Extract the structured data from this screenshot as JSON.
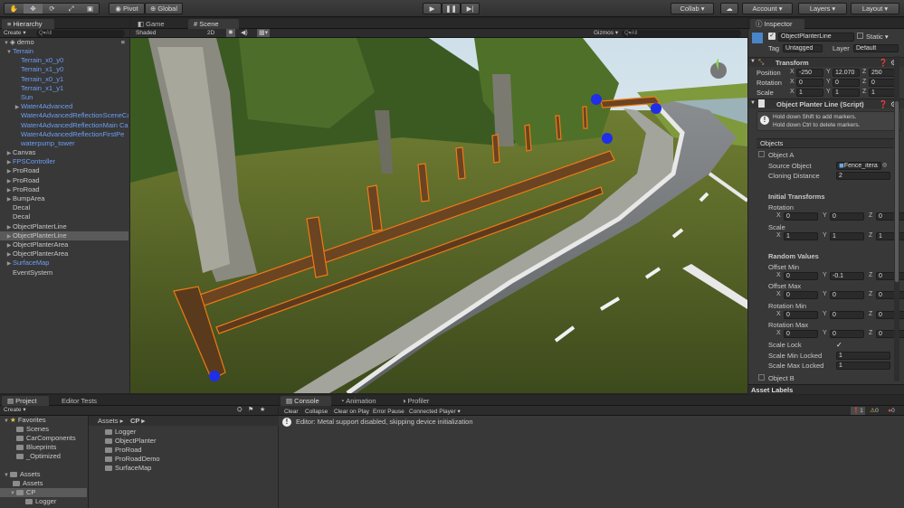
{
  "toolbar": {
    "pivot": "Pivot",
    "global": "Global",
    "collab": "Collab ▾",
    "account": "Account ▾",
    "layers": "Layers ▾",
    "layout": "Layout ▾"
  },
  "hierarchy": {
    "tab": "Hierarchy",
    "create": "Create ▾",
    "search_placeholder": "Q▾All",
    "scene": "demo",
    "items": [
      {
        "label": "Terrain",
        "indent": 1,
        "arrow": "▼",
        "blue": true
      },
      {
        "label": "Terrain_x0_y0",
        "indent": 2,
        "blue": true
      },
      {
        "label": "Terrain_x1_y0",
        "indent": 2,
        "blue": true
      },
      {
        "label": "Terrain_x0_y1",
        "indent": 2,
        "blue": true
      },
      {
        "label": "Terrain_x1_y1",
        "indent": 2,
        "blue": true
      },
      {
        "label": "Sun",
        "indent": 2,
        "blue": true
      },
      {
        "label": "Water4Advanced",
        "indent": 2,
        "arrow": "▶",
        "blue": true
      },
      {
        "label": "Water4AdvancedReflectionSceneCa",
        "indent": 2,
        "blue": true
      },
      {
        "label": "Water4AdvancedReflectionMain Ca",
        "indent": 2,
        "blue": true
      },
      {
        "label": "Water4AdvancedReflectionFirstPe",
        "indent": 2,
        "blue": true
      },
      {
        "label": "waterpump_tower",
        "indent": 2,
        "blue": true
      },
      {
        "label": "Canvas",
        "indent": 1,
        "arrow": "▶"
      },
      {
        "label": "FPSController",
        "indent": 1,
        "arrow": "▶",
        "blue": true
      },
      {
        "label": "ProRoad",
        "indent": 1,
        "arrow": "▶"
      },
      {
        "label": "ProRoad",
        "indent": 1,
        "arrow": "▶"
      },
      {
        "label": "ProRoad",
        "indent": 1,
        "arrow": "▶"
      },
      {
        "label": "BumpArea",
        "indent": 1,
        "arrow": "▶"
      },
      {
        "label": "Decal",
        "indent": 1
      },
      {
        "label": "Decal",
        "indent": 1
      },
      {
        "label": "ObjectPlanterLine",
        "indent": 1,
        "arrow": "▶"
      },
      {
        "label": "ObjectPlanterLine",
        "indent": 1,
        "arrow": "▶",
        "selected": true
      },
      {
        "label": "ObjectPlanterArea",
        "indent": 1,
        "arrow": "▶"
      },
      {
        "label": "ObjectPlanterArea",
        "indent": 1,
        "arrow": "▶"
      },
      {
        "label": "SurfaceMap",
        "indent": 1,
        "arrow": "▶",
        "blue": true
      },
      {
        "label": "EventSystem",
        "indent": 1
      }
    ]
  },
  "scene": {
    "game_tab": "Game",
    "scene_tab": "Scene",
    "shaded": "Shaded",
    "mode_2d": "2D",
    "gizmos": "Gizmos ▾",
    "search": "Q▾All"
  },
  "inspector": {
    "tab": "Inspector",
    "object_name": "ObjectPlanterLine",
    "static": "Static ▾",
    "tag_label": "Tag",
    "tag_value": "Untagged",
    "layer_label": "Layer",
    "layer_value": "Default",
    "transform": {
      "title": "Transform",
      "position": "Position",
      "rotation": "Rotation",
      "scale": "Scale",
      "px": "-250",
      "py": "12.070",
      "pz": "250",
      "rx": "0",
      "ry": "0",
      "rz": "0",
      "sx": "1",
      "sy": "1",
      "sz": "1"
    },
    "script": {
      "title": "Object Planter Line (Script)",
      "help1": "Hold down Shift to add markers.",
      "help2": "Hold down Ctrl to delete markers.",
      "objects": "Objects",
      "object_a": "Object A",
      "source_object": "Source Object",
      "source_value": "Fence_itera",
      "cloning_distance": "Cloning Distance",
      "cloning_value": "2",
      "initial_transforms": "Initial Transforms",
      "rotation": "Rotation",
      "scale": "Scale",
      "random_values": "Random Values",
      "offset_min": "Offset Min",
      "offset_max": "Offset Max",
      "rotation_min": "Rotation Min",
      "rotation_max": "Rotation Max",
      "scale_lock": "Scale Lock",
      "scale_min_locked": "Scale Min Locked",
      "scale_max_locked": "Scale Max Locked",
      "object_b": "Object B"
    },
    "vals": {
      "ir_x": "0",
      "ir_y": "0",
      "ir_z": "0",
      "is_x": "1",
      "is_y": "1",
      "is_z": "1",
      "omin_x": "0",
      "omin_y": "-0.1",
      "omin_z": "0",
      "omax_x": "0",
      "omax_y": "0",
      "omax_z": "0",
      "rmin_x": "0",
      "rmin_y": "0",
      "rmin_z": "0",
      "rmax_x": "0",
      "rmax_y": "0",
      "rmax_z": "0",
      "sminl": "1",
      "smaxl": "1"
    },
    "asset_labels": "Asset Labels"
  },
  "axes": {
    "x": "X",
    "y": "Y",
    "z": "Z"
  },
  "project": {
    "tab": "Project",
    "editor_tests": "Editor Tests",
    "create": "Create ▾",
    "favorites": "Favorites",
    "fav_items": [
      "Scenes",
      "CarComponents",
      "Blueprints",
      "_Optimized"
    ],
    "assets": "Assets",
    "assets_items": [
      "Assets",
      "CP",
      "Logger"
    ],
    "breadcrumb_assets": "Assets ▸",
    "breadcrumb_cp": "CP ▸",
    "folders": [
      "Logger",
      "ObjectPlanter",
      "ProRoad",
      "ProRoadDemo",
      "SurfaceMap"
    ]
  },
  "console": {
    "tab": "Console",
    "animation": "Animation",
    "profiler": "Profiler",
    "clear": "Clear",
    "collapse": "Collapse",
    "clear_on_play": "Clear on Play",
    "error_pause": "Error Pause",
    "connected_player": "Connected Player ▾",
    "message": "Editor: Metal support disabled, skipping device initialization",
    "count_info": "1",
    "count_warn": "0",
    "count_err": "0"
  }
}
